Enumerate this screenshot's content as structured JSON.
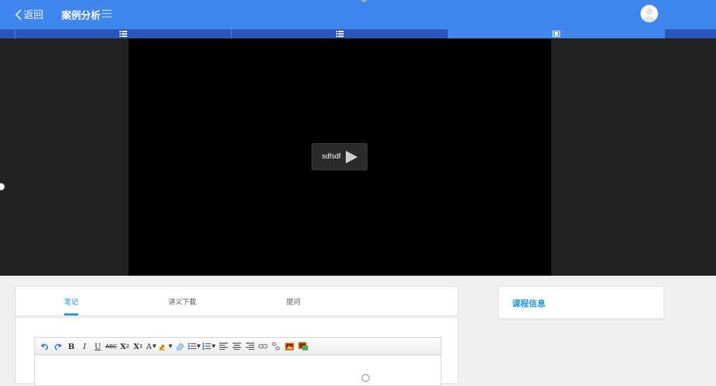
{
  "header": {
    "back_label": "返回",
    "title": "案例分析"
  },
  "tabs": [
    {
      "icon": "list-icon",
      "active": false
    },
    {
      "icon": "list-icon",
      "active": false
    },
    {
      "icon": "film-icon",
      "active": true
    }
  ],
  "video": {
    "play_label": "sdfsdf"
  },
  "notes": {
    "tabs": [
      {
        "label": "笔记",
        "active": true
      },
      {
        "label": "讲义下载",
        "active": false
      },
      {
        "label": "提问",
        "active": false
      }
    ],
    "toolbar": [
      "undo-icon",
      "redo-icon",
      "bold-icon",
      "italic-icon",
      "underline-icon",
      "strikethrough-icon",
      "superscript-icon",
      "subscript-icon",
      "font-color-icon",
      "highlight-icon",
      "eraser-icon",
      "unordered-list-icon",
      "ordered-list-icon",
      "align-left-icon",
      "align-center-icon",
      "align-right-icon",
      "link-icon",
      "unlink-icon",
      "image-icon",
      "insert-image-icon"
    ]
  },
  "course_info": {
    "title": "课程信息"
  },
  "colors": {
    "header": "#3f86ef",
    "tabs_bar": "#2a55b9",
    "accent": "#2196d8"
  }
}
